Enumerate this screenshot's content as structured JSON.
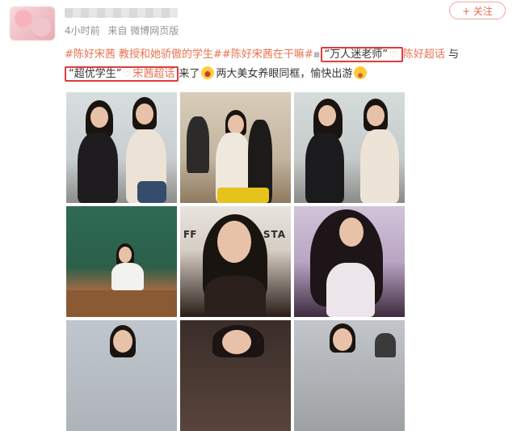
{
  "post": {
    "time": "4小时前",
    "source": "来自 微博网页版",
    "follow_label": "+ 关注",
    "text": {
      "topic1": "#陈好宋茜 教授和她骄傲的学生#",
      "topic2": "#陈好宋茜在干嘛#",
      "quote1": "“万人迷老师”",
      "user1": "陈好超话",
      "conj": " 与 ",
      "quote2": "“超优学生”",
      "user2": "宋茜超话",
      "tail1": "来了",
      "tail2": "两大美女养眼同框，愉快出游"
    },
    "images": [
      {
        "alt": "photo-1"
      },
      {
        "alt": "photo-2"
      },
      {
        "alt": "photo-3"
      },
      {
        "alt": "photo-4"
      },
      {
        "alt": "photo-5"
      },
      {
        "alt": "photo-6"
      },
      {
        "alt": "photo-7"
      },
      {
        "alt": "photo-8"
      },
      {
        "alt": "photo-9"
      }
    ],
    "sign_text_1": "FF",
    "sign_text_2": "STA"
  },
  "colors": {
    "accent": "#eb7350",
    "highlight_box": "#e03b3b",
    "meta": "#939393"
  }
}
